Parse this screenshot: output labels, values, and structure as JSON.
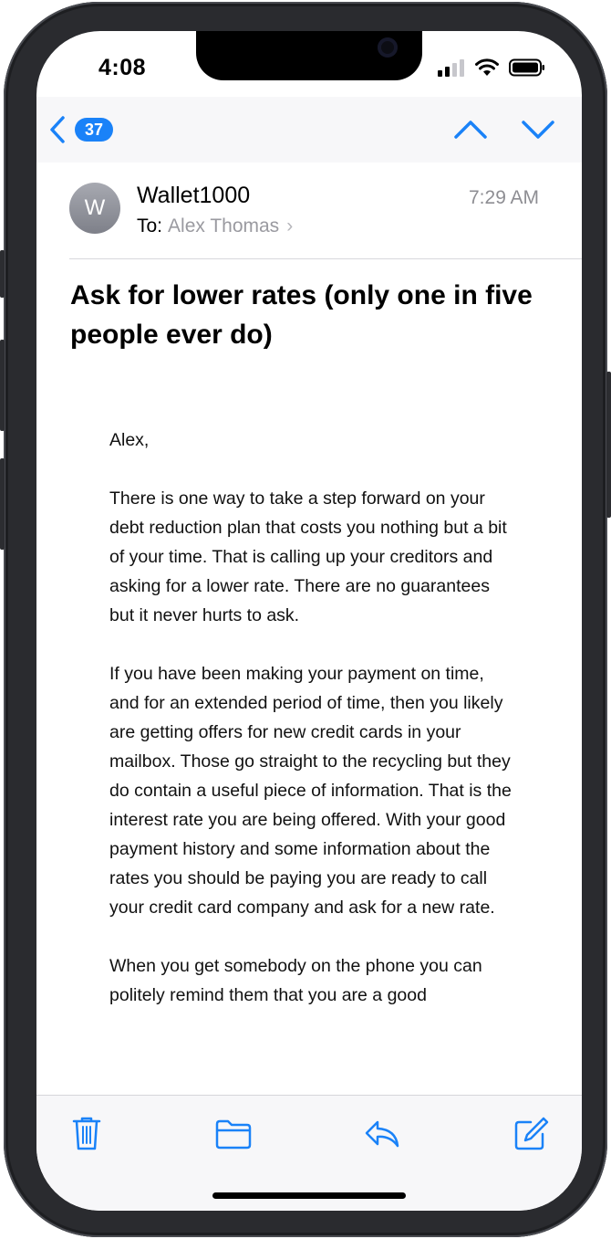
{
  "status_bar": {
    "time": "4:08"
  },
  "nav": {
    "unread_count": "37",
    "icons": [
      "chevron-left-icon",
      "chevron-up-icon",
      "chevron-down-icon"
    ]
  },
  "message": {
    "avatar_initial": "W",
    "sender": "Wallet1000",
    "to_label": "To:",
    "recipient": "Alex Thomas",
    "time": "7:29 AM",
    "subject": "Ask for lower rates (only one in five people ever do)",
    "paragraphs": [
      "Alex,",
      "There is one way to take a step forward on your debt reduction plan that costs you nothing but a bit of your time. That is calling up your creditors and asking for a lower rate. There are no guarantees but it never hurts to ask.",
      "If you have been making your payment on time, and for an extended period of time, then you likely are getting offers for new credit cards in your mailbox. Those go straight to the recycling but they do contain a useful piece of information. That is the interest rate you are being offered. With your good payment history and some information about the rates you should be paying you are ready to call your credit card company and ask for a new rate.",
      "When you get somebody on the phone you can politely remind them that you are a good"
    ]
  },
  "toolbar": {
    "icons": [
      "trash-icon",
      "folder-icon",
      "reply-icon",
      "compose-icon"
    ]
  },
  "colors": {
    "accent": "#1a82f8",
    "secondary_text": "#8e8e93"
  }
}
